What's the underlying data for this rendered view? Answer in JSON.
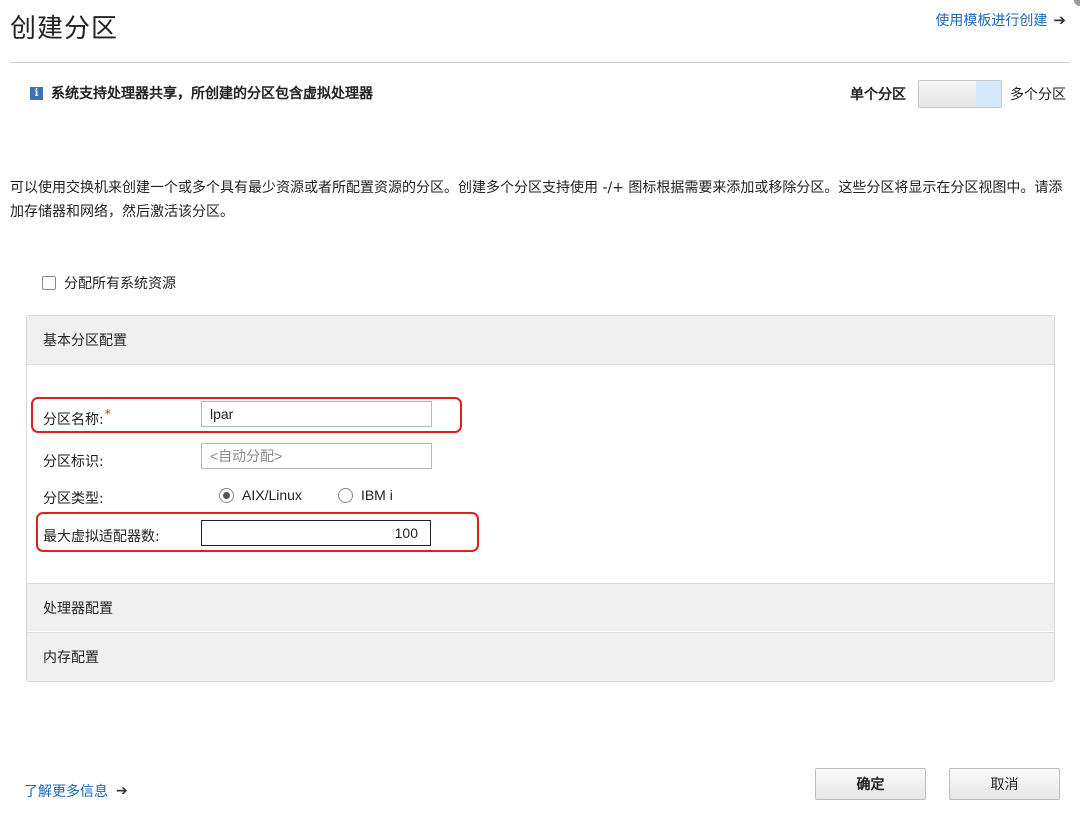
{
  "page": {
    "title": "创建分区",
    "template_link": "使用模板进行创建"
  },
  "info": {
    "text": "系统支持处理器共享，所创建的分区包含虚拟处理器"
  },
  "toggle": {
    "left_label": "单个分区",
    "right_label": "多个分区",
    "selected": "多个分区"
  },
  "description": "可以使用交换机来创建一个或多个具有最少资源或者所配置资源的分区。创建多个分区支持使用 -/+ 图标根据需要来添加或移除分区。这些分区将显示在分区视图中。请添加存储器和网络，然后激活该分区。",
  "allocate_all": {
    "label": "分配所有系统资源",
    "checked": false
  },
  "basic_section": {
    "header": "基本分区配置",
    "name_label": "分区名称:",
    "required_mark": "*",
    "name_value": "lpar",
    "id_label": "分区标识:",
    "id_placeholder": "<自动分配>",
    "type_label": "分区类型:",
    "type_options": [
      "AIX/Linux",
      "IBM i"
    ],
    "type_selected": "AIX/Linux",
    "max_adapters_label": "最大虚拟适配器数:",
    "max_adapters_value": "100"
  },
  "processor_section": {
    "header": "处理器配置"
  },
  "memory_section": {
    "header": "内存配置"
  },
  "footer": {
    "learn_more": "了解更多信息",
    "ok_label": "确定",
    "cancel_label": "取消"
  },
  "colors": {
    "link": "#1f66b5",
    "highlight_box": "#e0201c",
    "toggle_on": "#d4e9fb"
  }
}
